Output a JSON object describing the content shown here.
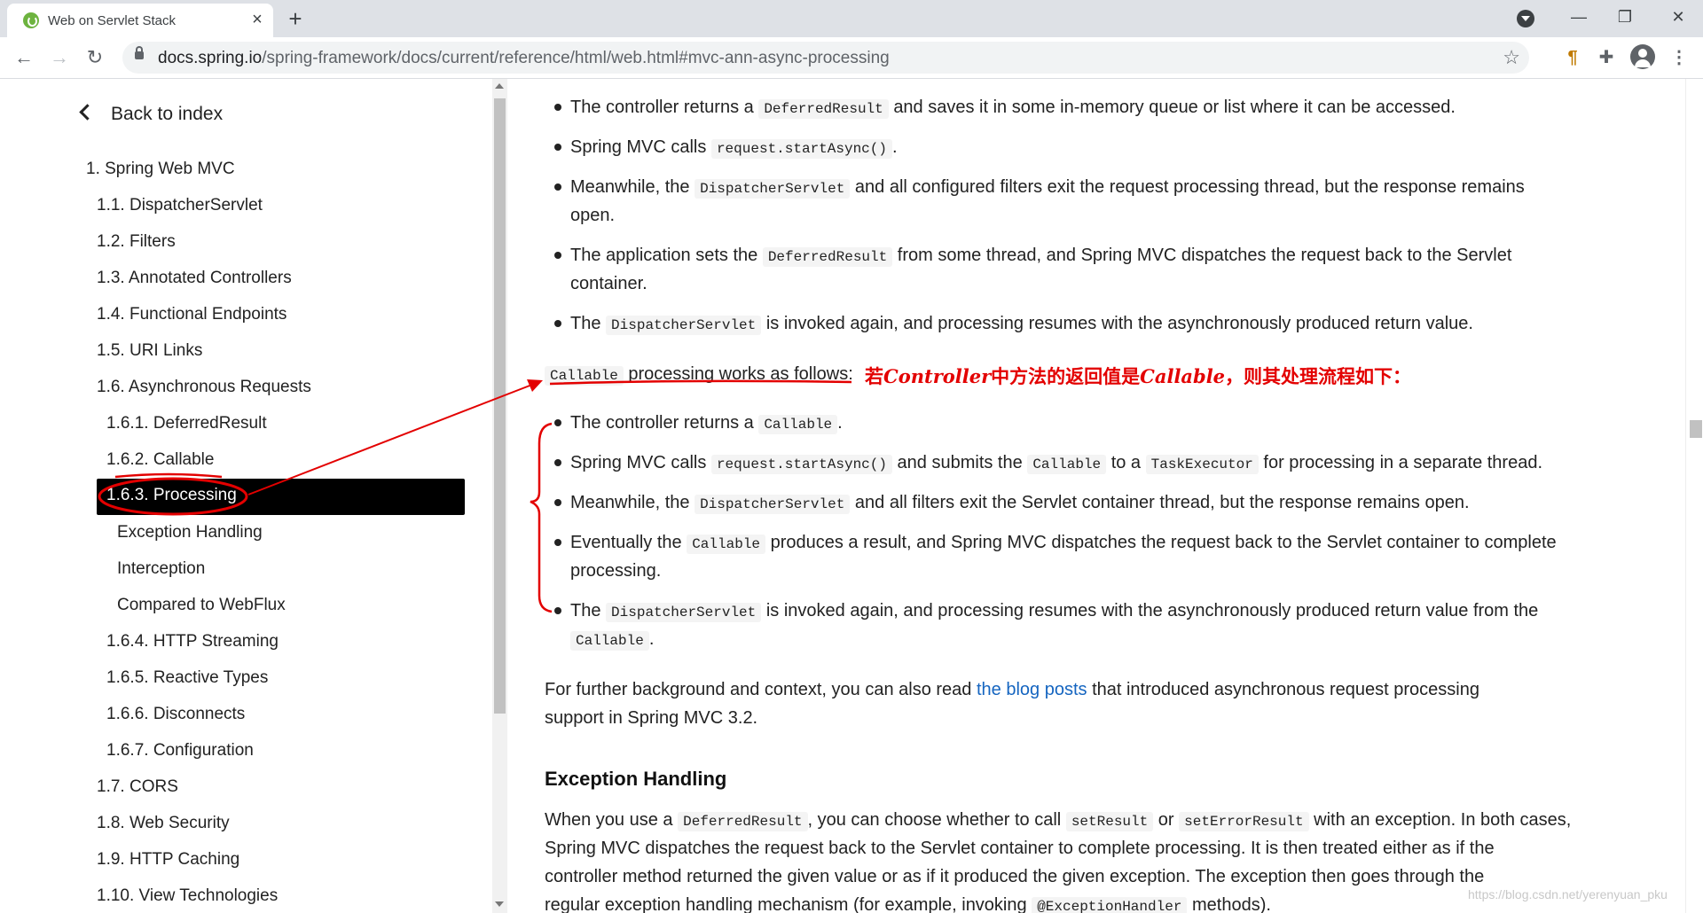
{
  "browser": {
    "tab_title": "Web on Servlet Stack",
    "url_host": "docs.spring.io",
    "url_path": "/spring-framework/docs/current/reference/html/web.html#mvc-ann-async-processing"
  },
  "sidebar": {
    "back_label": "Back to index",
    "items": [
      "1. Spring Web MVC",
      "1.1. DispatcherServlet",
      "1.2. Filters",
      "1.3. Annotated Controllers",
      "1.4. Functional Endpoints",
      "1.5. URI Links",
      "1.6. Asynchronous Requests",
      "1.6.1. DeferredResult",
      "1.6.2. Callable",
      "1.6.3. Processing",
      "Exception Handling",
      "Interception",
      "Compared to WebFlux",
      "1.6.4. HTTP Streaming",
      "1.6.5. Reactive Types",
      "1.6.6. Disconnects",
      "1.6.7. Configuration",
      "1.7. CORS",
      "1.8. Web Security",
      "1.9. HTTP Caching",
      "1.10. View Technologies"
    ]
  },
  "content": {
    "deferred_steps": {
      "s1_a": "The controller returns a",
      "s1_code": "DeferredResult",
      "s1_b": "and saves it in some in-memory queue or list where it can be accessed.",
      "s2_a": "Spring MVC calls",
      "s2_code": "request.startAsync()",
      "s2_b": ".",
      "s3_a": "Meanwhile, the",
      "s3_code": "DispatcherServlet",
      "s3_b": "and all configured filters exit the request processing thread, but the response remains",
      "s3_c": "open.",
      "s4_a": "The application sets the",
      "s4_code": "DeferredResult",
      "s4_b": "from some thread, and Spring MVC dispatches the request back to the Servlet",
      "s4_c": "container.",
      "s5_a": "The",
      "s5_code": "DispatcherServlet",
      "s5_b": "is invoked again, and processing resumes with the asynchronously produced return value."
    },
    "callable_intro_code": "Callable",
    "callable_intro_text": "processing works as follows:",
    "callable_steps": {
      "s1_a": "The controller returns a",
      "s1_code": "Callable",
      "s1_b": ".",
      "s2_a": "Spring MVC calls",
      "s2_code1": "request.startAsync()",
      "s2_b": "and submits the",
      "s2_code2": "Callable",
      "s2_c": "to a",
      "s2_code3": "TaskExecutor",
      "s2_d": "for processing in a separate thread.",
      "s3_a": "Meanwhile, the",
      "s3_code": "DispatcherServlet",
      "s3_b": "and all filters exit the Servlet container thread, but the response remains open.",
      "s4_a": "Eventually the",
      "s4_code": "Callable",
      "s4_b": "produces a result, and Spring MVC dispatches the request back to the Servlet container to complete",
      "s4_c": "processing.",
      "s5_a": "The",
      "s5_code": "DispatcherServlet",
      "s5_b": "is invoked again, and processing resumes with the asynchronously produced return value from the",
      "s5_code2": "Callable",
      "s5_c": "."
    },
    "background": {
      "a": "For further background and context, you can also read",
      "link": "the blog posts",
      "b": "that introduced asynchronous request processing",
      "c": "support in Spring MVC 3.2."
    },
    "exception_heading": "Exception Handling",
    "exception": {
      "a": "When you use a",
      "code1": "DeferredResult",
      "b": ", you can choose whether to call",
      "code2": "setResult",
      "c": "or",
      "code3": "setErrorResult",
      "d": "with an exception. In both cases,",
      "line2": "Spring MVC dispatches the request back to the Servlet container to complete processing. It is then treated either as if the",
      "line3": "controller method returned the given value or as if it produced the given exception. The exception then goes through the",
      "line4_a": "regular exception handling mechanism (for example, invoking",
      "line4_code": "@ExceptionHandler",
      "line4_b": "methods)."
    }
  },
  "annotation": {
    "p1": "若",
    "p2": "Controller",
    "p3": "中方法的返回值是",
    "p4": "Callable",
    "p5": "，则其处理流程如下：",
    "color": "#e30000"
  },
  "watermark": "https://blog.csdn.net/yerenyuan_pku"
}
